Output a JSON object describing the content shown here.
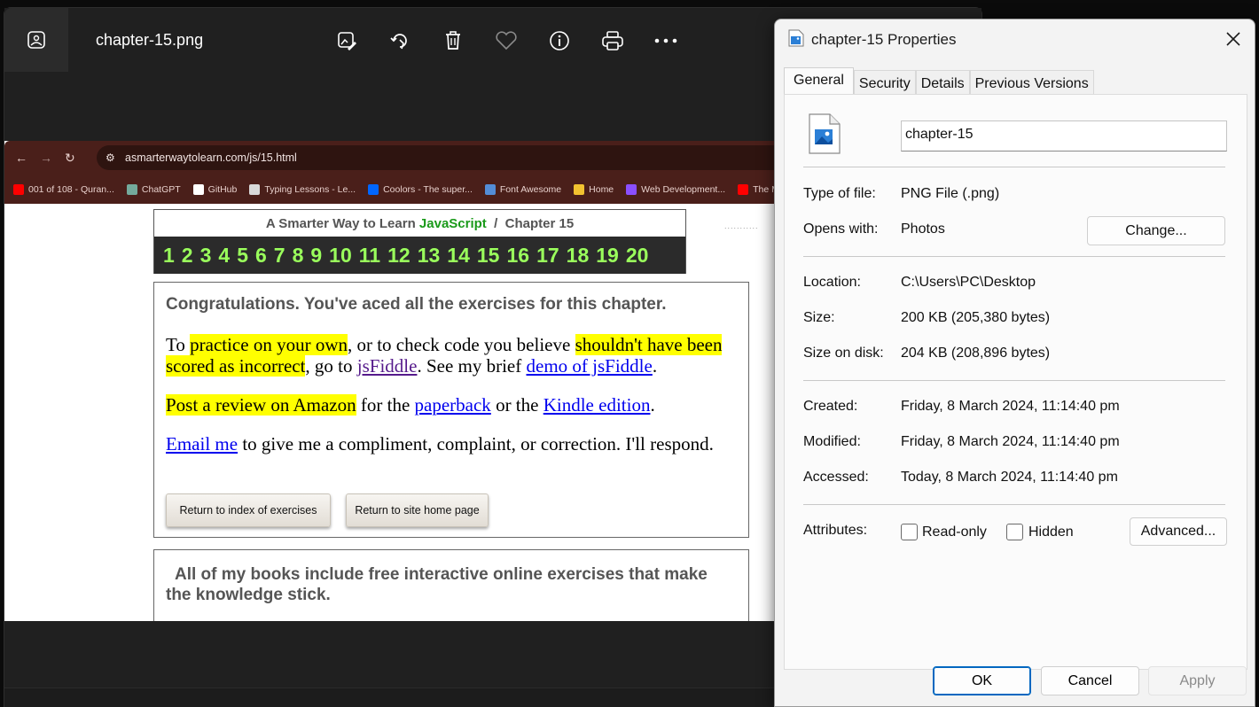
{
  "photos": {
    "file_name": "chapter-15.png",
    "tools": [
      {
        "name": "edit-image-icon"
      },
      {
        "name": "rotate-icon"
      },
      {
        "name": "delete-icon"
      },
      {
        "name": "favorite-heart-icon"
      },
      {
        "name": "info-icon"
      },
      {
        "name": "print-icon"
      },
      {
        "name": "more-options-icon"
      }
    ]
  },
  "browser": {
    "url": "asmarterwaytolearn.com/js/15.html",
    "bookmarks": [
      {
        "label": "001 of 108 - Quran...",
        "color": "#ff0000"
      },
      {
        "label": "ChatGPT",
        "color": "#74aa9c"
      },
      {
        "label": "GitHub",
        "color": "#ffffff"
      },
      {
        "label": "Typing Lessons - Le...",
        "color": "#d9d9d9"
      },
      {
        "label": "Coolors - The super...",
        "color": "#0066ff"
      },
      {
        "label": "Font Awesome",
        "color": "#538dd7"
      },
      {
        "label": "Home",
        "color": "#f2c230"
      },
      {
        "label": "Web Development...",
        "color": "#8a4fff"
      },
      {
        "label": "The M",
        "color": "#ff0000"
      }
    ]
  },
  "page": {
    "header_prefix": "A Smarter Way to Learn ",
    "header_js": "JavaScript",
    "header_suffix": "  /  Chapter 15",
    "chapters": [
      "1",
      "2",
      "3",
      "4",
      "5",
      "6",
      "7",
      "8",
      "9",
      "10",
      "11",
      "12",
      "13",
      "14",
      "15",
      "16",
      "17",
      "18",
      "19",
      "20"
    ],
    "congrats_heading": "Congratulations. You've aced all the exercises for this chapter.",
    "p1": {
      "a": "To ",
      "hl1": "practice on your own",
      "b": ", or to check code you believe ",
      "hl2": "shouldn't have been scored as incorrect",
      "c": ", go to ",
      "link1": "jsFiddle",
      "d": ". See my brief ",
      "link2": "demo of jsFiddle",
      "e": "."
    },
    "p2": {
      "hl": "Post a review on Amazon",
      "a": " for the ",
      "link1": "paperback",
      "b": " or the ",
      "link2": "Kindle edition",
      "c": "."
    },
    "p3": {
      "link": "Email me",
      "a": " to give me a compliment, complaint, or correction. I'll respond."
    },
    "btn_index": "Return to index of exercises",
    "btn_home": "Return to site home page",
    "books_text": "All of my books include free interactive online exercises that make the knowledge stick."
  },
  "dialog": {
    "title": "chapter-15 Properties",
    "tabs": [
      "General",
      "Security",
      "Details",
      "Previous Versions"
    ],
    "file_name": "chapter-15",
    "type_label": "Type of file:",
    "type_value": "PNG File (.png)",
    "opens_label": "Opens with:",
    "opens_value": "Photos",
    "change_btn": "Change...",
    "location_label": "Location:",
    "location_value": "C:\\Users\\PC\\Desktop",
    "size_label": "Size:",
    "size_value": "200 KB (205,380 bytes)",
    "disk_label": "Size on disk:",
    "disk_value": "204 KB (208,896 bytes)",
    "created_label": "Created:",
    "created_value": "Friday, 8 March 2024, 11:14:40 pm",
    "modified_label": "Modified:",
    "modified_value": "Friday, 8 March 2024, 11:14:40 pm",
    "accessed_label": "Accessed:",
    "accessed_value": "Today, 8 March 2024, 11:14:40 pm",
    "attributes_label": "Attributes:",
    "readonly_label": "Read-only",
    "hidden_label": "Hidden",
    "advanced_btn": "Advanced...",
    "ok": "OK",
    "cancel": "Cancel",
    "apply": "Apply"
  }
}
